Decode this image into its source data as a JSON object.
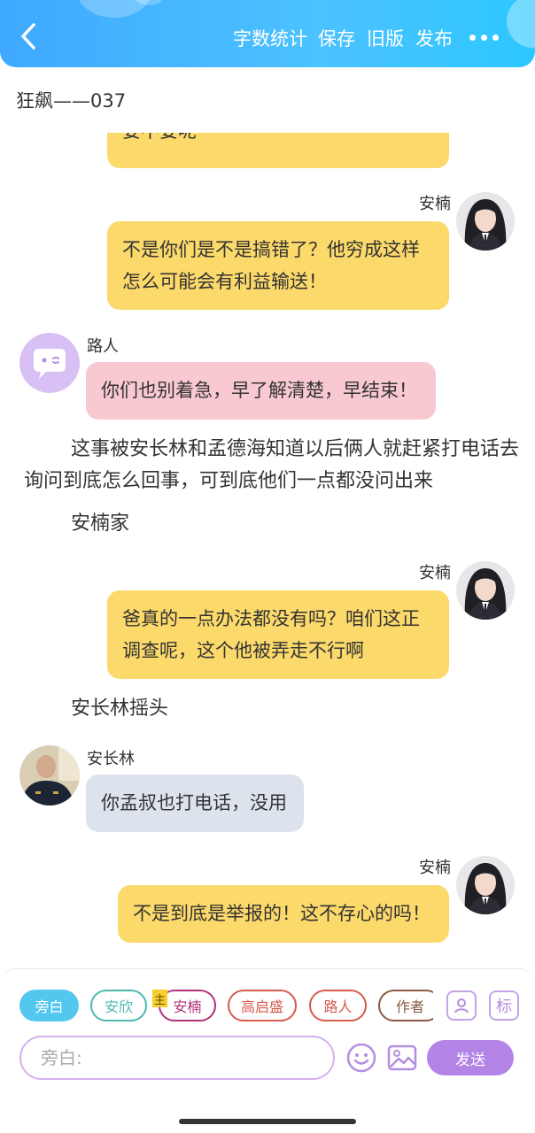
{
  "header": {
    "actions": [
      "字数统计",
      "保存",
      "旧版",
      "发布"
    ]
  },
  "doc_title": "狂飙——037",
  "messages": [
    {
      "text": "要不要呢"
    },
    {
      "speaker": "安楠",
      "text_lines": [
        "不是你们是不是搞错了？他穷成这样",
        "怎么可能会有利益输送！"
      ]
    },
    {
      "speaker": "路人",
      "text": "你们也别着急，早了解清楚，早结束！"
    },
    {
      "narration_lines": [
        "这事被安长林和孟德海知道以后俩人就赶紧打电话去",
        "询问到底怎么回事，可到底他们一点都没问出来"
      ]
    },
    {
      "narration": "安楠家"
    },
    {
      "speaker": "安楠",
      "text_lines": [
        "爸真的一点办法都没有吗？咱们这正",
        "调查呢，这个他被弄走不行啊"
      ]
    },
    {
      "narration": "安长林摇头"
    },
    {
      "speaker": "安长林",
      "text": "你孟叔也打电话，没用"
    },
    {
      "speaker": "安楠",
      "text": "不是到底是举报的！这不存心的吗！"
    }
  ],
  "roles": [
    {
      "label": "旁白",
      "color": "#54c7ef"
    },
    {
      "label": "安欣",
      "color": "#4cb8b0"
    },
    {
      "label": "安楠",
      "color": "#b0327a",
      "badge": "主"
    },
    {
      "label": "高启盛",
      "color": "#d65a4e"
    },
    {
      "label": "路人",
      "color": "#d65a4e"
    },
    {
      "label": "作者",
      "color": "#8a5a44"
    }
  ],
  "tools": {
    "role_icon": "person-card-icon",
    "mark": "标"
  },
  "composer": {
    "placeholder": "旁白:",
    "emoji_icon": "emoji-icon",
    "image_icon": "image-icon",
    "send": "发送"
  }
}
